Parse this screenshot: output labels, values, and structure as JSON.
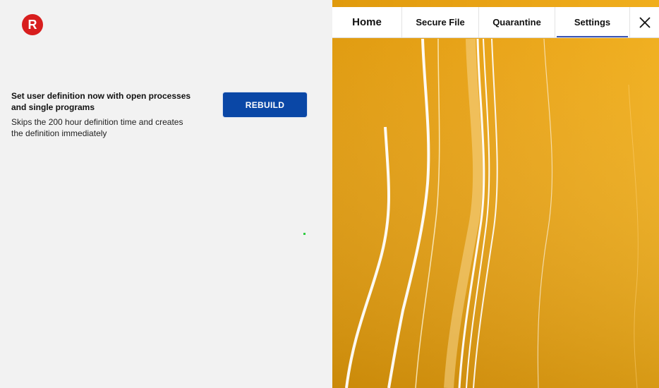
{
  "app": {
    "logo_letter": "R",
    "brand_color": "#d81e1e"
  },
  "tabs": [
    {
      "label": "Home"
    },
    {
      "label": "Secure File"
    },
    {
      "label": "Quarantine"
    },
    {
      "label": "Settings",
      "active": true
    }
  ],
  "setting": {
    "title": "Set user definition now with open processes and single programs",
    "description": "Skips the 200 hour definition time and creates the definition immediately",
    "button_label": "REBUILD"
  },
  "colors": {
    "accent": "#0a47a6",
    "active_tab_underline": "#3b56b5",
    "wallpaper": "#e2a10e",
    "status_dot": "#2ecc40"
  },
  "icons": {
    "close": "close-icon",
    "logo": "app-logo-icon"
  }
}
